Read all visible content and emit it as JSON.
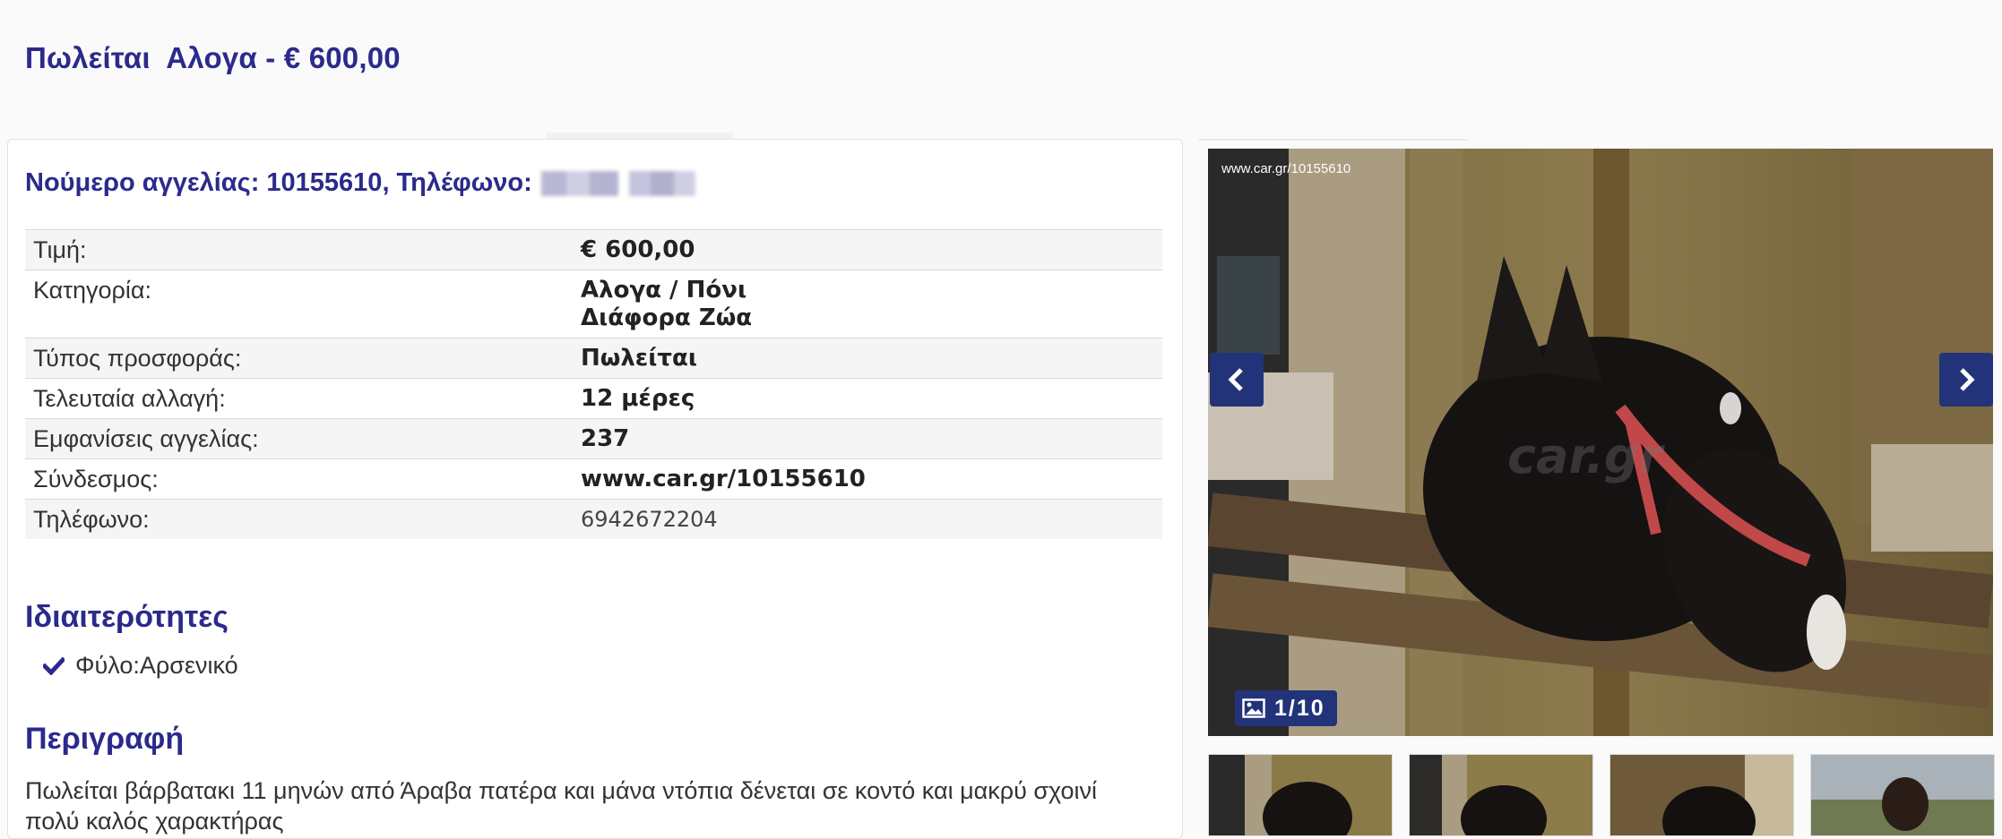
{
  "page": {
    "title": "Πωλείται  Αλογα - € 600,00"
  },
  "ad": {
    "header_prefix": "Νούμερο αγγελίας: 10155610, Τηλέφωνο:"
  },
  "details": [
    {
      "label": "Τιμή:",
      "value": "€ 600,00"
    },
    {
      "label": "Κατηγορία:",
      "value": "Αλογα / Πόνι",
      "value2": "Διάφορα Ζώα"
    },
    {
      "label": "Τύπος προσφοράς:",
      "value": "Πωλείται"
    },
    {
      "label": "Τελευταία αλλαγή:",
      "value": "12 μέρες"
    },
    {
      "label": "Εμφανίσεις αγγελίας:",
      "value": "237"
    },
    {
      "label": "Σύνδεσμος:",
      "value": "www.car.gr/10155610"
    },
    {
      "label": "Τηλέφωνο:",
      "value": "6942672204"
    }
  ],
  "features": {
    "heading": "Ιδιαιτερότητες",
    "items": [
      {
        "label": "Φύλο:",
        "value": "Αρσενικό"
      }
    ]
  },
  "description": {
    "heading": "Περιγραφή",
    "text": "Πωλείται βάρβατακι 11 μηνών από Άραβα πατέρα και μάνα ντόπια δένεται σε κοντό και μακρύ σχοινί πολύ καλός χαρακτήρας"
  },
  "gallery": {
    "watermark_url": "www.car.gr/10155610",
    "watermark_logo": "car.gr",
    "counter": "1/10",
    "progress": 0.1,
    "icons": {
      "prev": "chevron-left-icon",
      "next": "chevron-right-icon",
      "counter": "image-icon"
    }
  },
  "colors": {
    "brand": "#2b2a8c",
    "button": "#23337a"
  }
}
